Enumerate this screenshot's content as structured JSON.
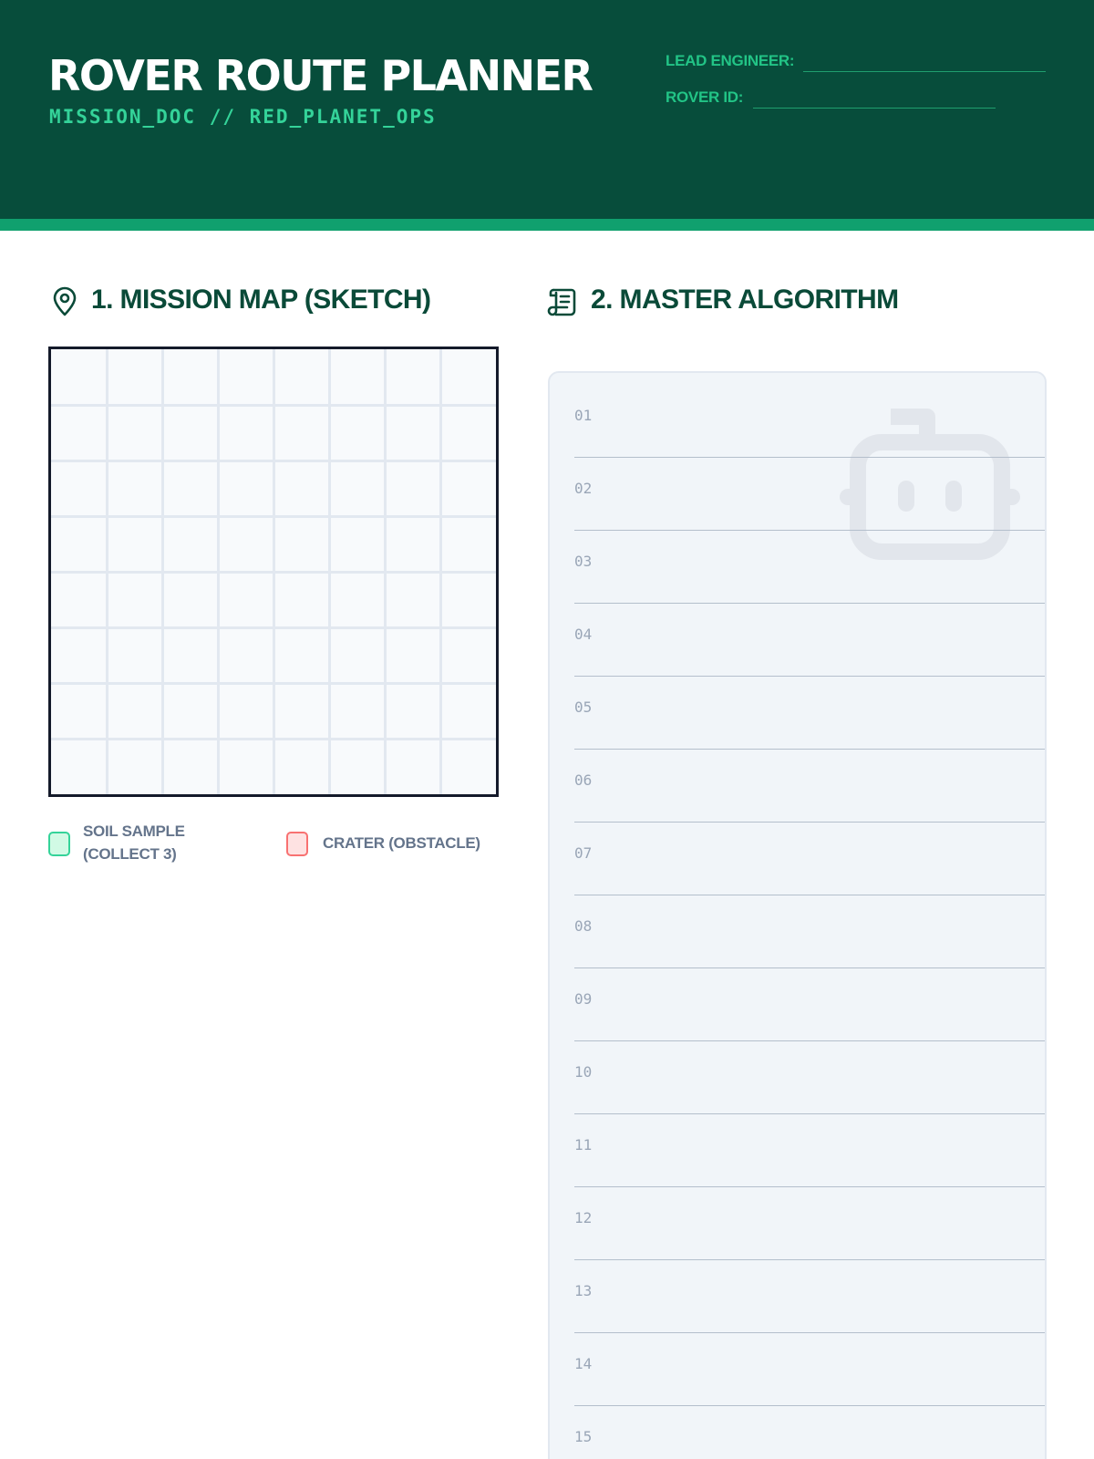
{
  "header": {
    "title": "ROVER ROUTE PLANNER",
    "subtitle": "MISSION_DOC // RED_PLANET_OPS",
    "fields": [
      {
        "label": "LEAD ENGINEER:"
      },
      {
        "label": "ROVER ID:"
      }
    ]
  },
  "colors": {
    "header_bg": "#074d3b",
    "accent": "#10a06e",
    "section_title": "#0a4a38",
    "soil_sample": "#34d399",
    "crater": "#f87171"
  },
  "map": {
    "title": "1. MISSION MAP (SKETCH)",
    "icon": "map-pin-icon",
    "grid": {
      "rows": 8,
      "cols": 8
    },
    "legend": [
      {
        "label_line1": "SOIL SAMPLE",
        "label_line2": "(COLLECT 3)",
        "color": "#34d399"
      },
      {
        "label_line1": "CRATER (OBSTACLE)",
        "label_line2": "",
        "color": "#f87171"
      }
    ]
  },
  "algorithm": {
    "title": "2. MASTER ALGORITHM",
    "icon": "scroll-icon",
    "watermark_icon": "robot-icon",
    "line_numbers": [
      "01",
      "02",
      "03",
      "04",
      "05",
      "06",
      "07",
      "08",
      "09",
      "10",
      "11",
      "12",
      "13",
      "14",
      "15"
    ]
  }
}
